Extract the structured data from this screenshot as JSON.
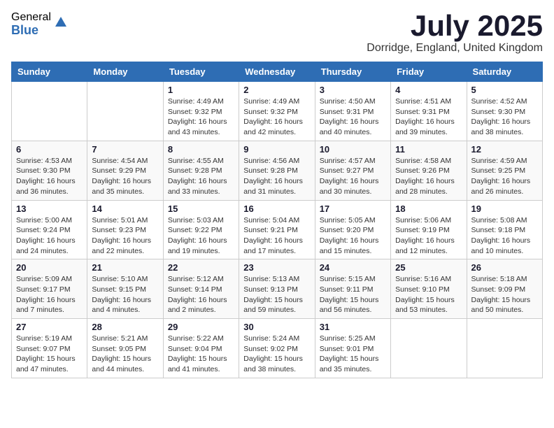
{
  "header": {
    "logo_general": "General",
    "logo_blue": "Blue",
    "month_title": "July 2025",
    "location": "Dorridge, England, United Kingdom"
  },
  "weekdays": [
    "Sunday",
    "Monday",
    "Tuesday",
    "Wednesday",
    "Thursday",
    "Friday",
    "Saturday"
  ],
  "weeks": [
    [
      {
        "day": "",
        "info": ""
      },
      {
        "day": "",
        "info": ""
      },
      {
        "day": "1",
        "info": "Sunrise: 4:49 AM\nSunset: 9:32 PM\nDaylight: 16 hours and 43 minutes."
      },
      {
        "day": "2",
        "info": "Sunrise: 4:49 AM\nSunset: 9:32 PM\nDaylight: 16 hours and 42 minutes."
      },
      {
        "day": "3",
        "info": "Sunrise: 4:50 AM\nSunset: 9:31 PM\nDaylight: 16 hours and 40 minutes."
      },
      {
        "day": "4",
        "info": "Sunrise: 4:51 AM\nSunset: 9:31 PM\nDaylight: 16 hours and 39 minutes."
      },
      {
        "day": "5",
        "info": "Sunrise: 4:52 AM\nSunset: 9:30 PM\nDaylight: 16 hours and 38 minutes."
      }
    ],
    [
      {
        "day": "6",
        "info": "Sunrise: 4:53 AM\nSunset: 9:30 PM\nDaylight: 16 hours and 36 minutes."
      },
      {
        "day": "7",
        "info": "Sunrise: 4:54 AM\nSunset: 9:29 PM\nDaylight: 16 hours and 35 minutes."
      },
      {
        "day": "8",
        "info": "Sunrise: 4:55 AM\nSunset: 9:28 PM\nDaylight: 16 hours and 33 minutes."
      },
      {
        "day": "9",
        "info": "Sunrise: 4:56 AM\nSunset: 9:28 PM\nDaylight: 16 hours and 31 minutes."
      },
      {
        "day": "10",
        "info": "Sunrise: 4:57 AM\nSunset: 9:27 PM\nDaylight: 16 hours and 30 minutes."
      },
      {
        "day": "11",
        "info": "Sunrise: 4:58 AM\nSunset: 9:26 PM\nDaylight: 16 hours and 28 minutes."
      },
      {
        "day": "12",
        "info": "Sunrise: 4:59 AM\nSunset: 9:25 PM\nDaylight: 16 hours and 26 minutes."
      }
    ],
    [
      {
        "day": "13",
        "info": "Sunrise: 5:00 AM\nSunset: 9:24 PM\nDaylight: 16 hours and 24 minutes."
      },
      {
        "day": "14",
        "info": "Sunrise: 5:01 AM\nSunset: 9:23 PM\nDaylight: 16 hours and 22 minutes."
      },
      {
        "day": "15",
        "info": "Sunrise: 5:03 AM\nSunset: 9:22 PM\nDaylight: 16 hours and 19 minutes."
      },
      {
        "day": "16",
        "info": "Sunrise: 5:04 AM\nSunset: 9:21 PM\nDaylight: 16 hours and 17 minutes."
      },
      {
        "day": "17",
        "info": "Sunrise: 5:05 AM\nSunset: 9:20 PM\nDaylight: 16 hours and 15 minutes."
      },
      {
        "day": "18",
        "info": "Sunrise: 5:06 AM\nSunset: 9:19 PM\nDaylight: 16 hours and 12 minutes."
      },
      {
        "day": "19",
        "info": "Sunrise: 5:08 AM\nSunset: 9:18 PM\nDaylight: 16 hours and 10 minutes."
      }
    ],
    [
      {
        "day": "20",
        "info": "Sunrise: 5:09 AM\nSunset: 9:17 PM\nDaylight: 16 hours and 7 minutes."
      },
      {
        "day": "21",
        "info": "Sunrise: 5:10 AM\nSunset: 9:15 PM\nDaylight: 16 hours and 4 minutes."
      },
      {
        "day": "22",
        "info": "Sunrise: 5:12 AM\nSunset: 9:14 PM\nDaylight: 16 hours and 2 minutes."
      },
      {
        "day": "23",
        "info": "Sunrise: 5:13 AM\nSunset: 9:13 PM\nDaylight: 15 hours and 59 minutes."
      },
      {
        "day": "24",
        "info": "Sunrise: 5:15 AM\nSunset: 9:11 PM\nDaylight: 15 hours and 56 minutes."
      },
      {
        "day": "25",
        "info": "Sunrise: 5:16 AM\nSunset: 9:10 PM\nDaylight: 15 hours and 53 minutes."
      },
      {
        "day": "26",
        "info": "Sunrise: 5:18 AM\nSunset: 9:09 PM\nDaylight: 15 hours and 50 minutes."
      }
    ],
    [
      {
        "day": "27",
        "info": "Sunrise: 5:19 AM\nSunset: 9:07 PM\nDaylight: 15 hours and 47 minutes."
      },
      {
        "day": "28",
        "info": "Sunrise: 5:21 AM\nSunset: 9:05 PM\nDaylight: 15 hours and 44 minutes."
      },
      {
        "day": "29",
        "info": "Sunrise: 5:22 AM\nSunset: 9:04 PM\nDaylight: 15 hours and 41 minutes."
      },
      {
        "day": "30",
        "info": "Sunrise: 5:24 AM\nSunset: 9:02 PM\nDaylight: 15 hours and 38 minutes."
      },
      {
        "day": "31",
        "info": "Sunrise: 5:25 AM\nSunset: 9:01 PM\nDaylight: 15 hours and 35 minutes."
      },
      {
        "day": "",
        "info": ""
      },
      {
        "day": "",
        "info": ""
      }
    ]
  ]
}
